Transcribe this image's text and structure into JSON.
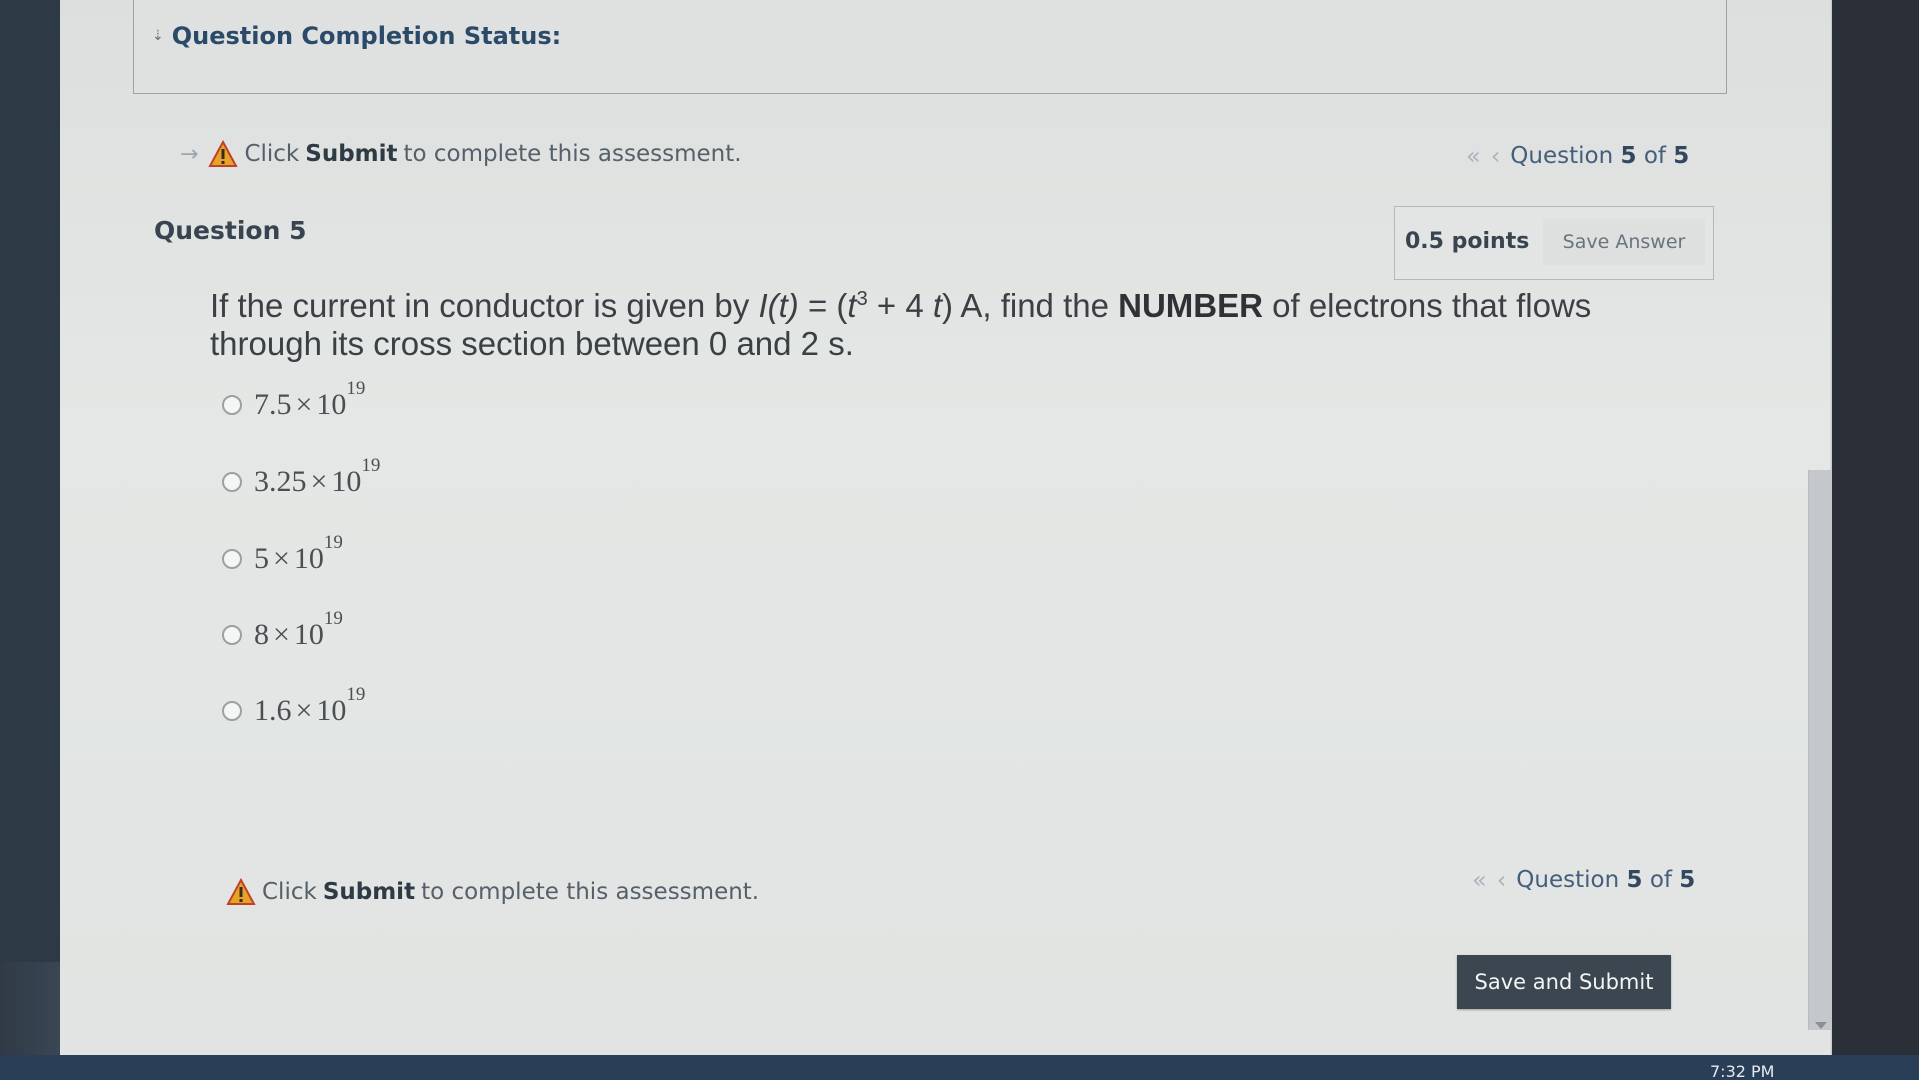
{
  "status": {
    "title": "Question Completion Status:"
  },
  "warning": {
    "prefix": "Click",
    "action": "Submit",
    "suffix": "to complete this assessment."
  },
  "nav": {
    "label_prefix": "Question",
    "current": "5",
    "of": "of",
    "total": "5",
    "first_icon": "double-chevron-left-icon",
    "prev_icon": "chevron-left-icon"
  },
  "question": {
    "title": "Question 5",
    "points": "0.5 points",
    "save_label": "Save Answer",
    "text_part1": "If the current in conductor is given by",
    "func": "I(t)",
    "eq": "=",
    "open": "(",
    "t1": "t",
    "exp": "3",
    "plus": "+ 4",
    "t2": "t",
    "close": ") A, find the",
    "keyword": "NUMBER",
    "text_part2": "of electrons that flows through its cross section between 0 and 2 s."
  },
  "options": [
    {
      "mantissa": "7.5",
      "times": "×",
      "base": "10",
      "exponent": "19"
    },
    {
      "mantissa": "3.25",
      "times": "×",
      "base": "10",
      "exponent": "19"
    },
    {
      "mantissa": "5",
      "times": "×",
      "base": "10",
      "exponent": "19"
    },
    {
      "mantissa": "8",
      "times": "×",
      "base": "10",
      "exponent": "19"
    },
    {
      "mantissa": "1.6",
      "times": "×",
      "base": "10",
      "exponent": "19"
    }
  ],
  "submit": {
    "label": "Save and Submit"
  },
  "taskbar": {
    "time": "7:32 PM"
  },
  "colors": {
    "accent": "#2b4a6a",
    "button": "#3b4650",
    "warning": "#e0a020"
  }
}
